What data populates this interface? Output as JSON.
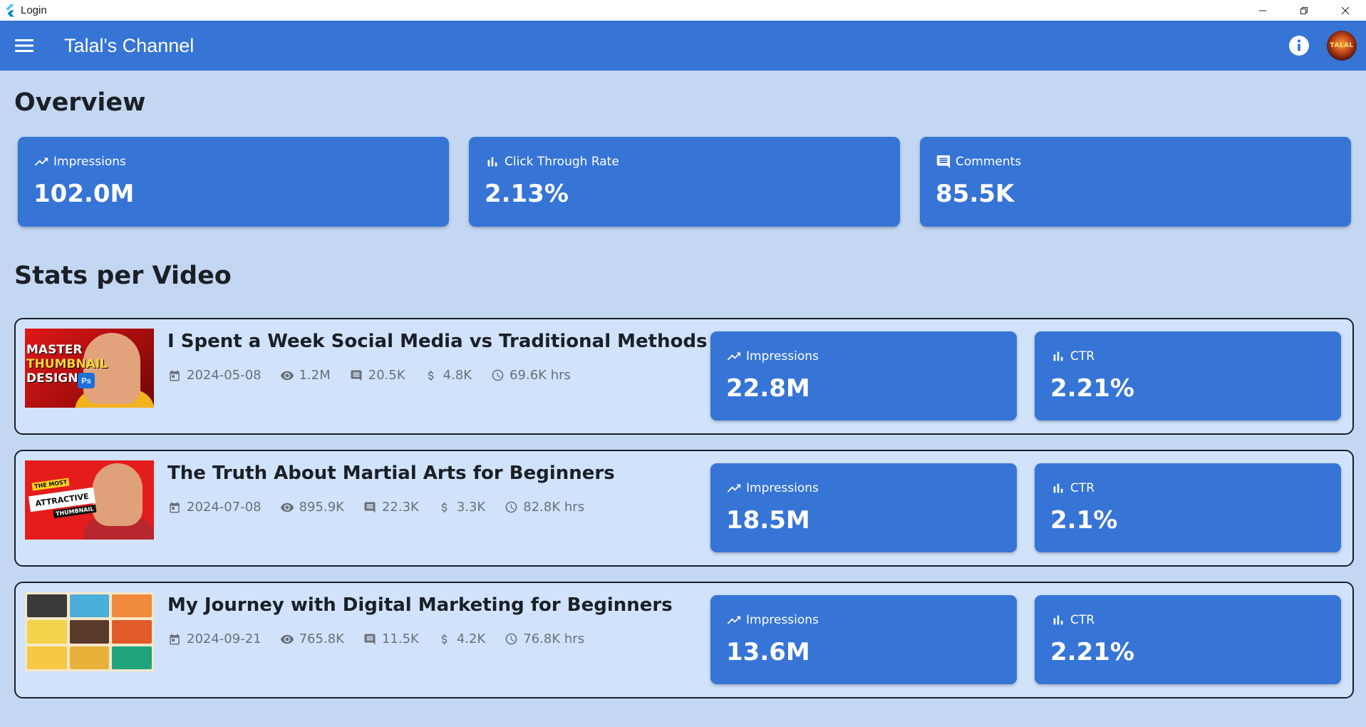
{
  "window": {
    "title": "Login"
  },
  "appbar": {
    "title": "Talal's Channel"
  },
  "avatar": {
    "text": "TALAL"
  },
  "overview": {
    "heading": "Overview",
    "cards": [
      {
        "label": "Impressions",
        "value": "102.0M",
        "icon": "trending-up-icon"
      },
      {
        "label": "Click Through Rate",
        "value": "2.13%",
        "icon": "bar-chart-icon"
      },
      {
        "label": "Comments",
        "value": "85.5K",
        "icon": "comment-icon"
      }
    ]
  },
  "stats": {
    "heading": "Stats per Video",
    "videos": [
      {
        "title": "I Spent a Week Social Media vs Traditional Methods",
        "date": "2024-05-08",
        "views": "1.2M",
        "comments": "20.5K",
        "revenue": "4.8K",
        "watch_time": "69.6K hrs",
        "impressions_label": "Impressions",
        "impressions": "22.8M",
        "ctr_label": "CTR",
        "ctr": "2.21%",
        "thumb": {
          "line1": "MASTER",
          "line2": "THUMBNAIL",
          "line3": "DESIGN",
          "badge": "Ps"
        }
      },
      {
        "title": "The Truth About Martial Arts for Beginners",
        "date": "2024-07-08",
        "views": "895.9K",
        "comments": "22.3K",
        "revenue": "3.3K",
        "watch_time": "82.8K hrs",
        "impressions_label": "Impressions",
        "impressions": "18.5M",
        "ctr_label": "CTR",
        "ctr": "2.1%",
        "thumb": {
          "top": "THE MOST",
          "main": "ATTRACTIVE",
          "sub": "THUMBNAIL"
        }
      },
      {
        "title": "My Journey with Digital Marketing for Beginners",
        "date": "2024-09-21",
        "views": "765.8K",
        "comments": "11.5K",
        "revenue": "4.2K",
        "watch_time": "76.8K hrs",
        "impressions_label": "Impressions",
        "impressions": "13.6M",
        "ctr_label": "CTR",
        "ctr": "2.21%"
      }
    ]
  },
  "colors": {
    "primary": "#3674d6",
    "background": "#c3d7f2",
    "row_bg": "#d0e3fb",
    "text_dark": "#1b1f26",
    "meta_text": "#6b6f76"
  }
}
